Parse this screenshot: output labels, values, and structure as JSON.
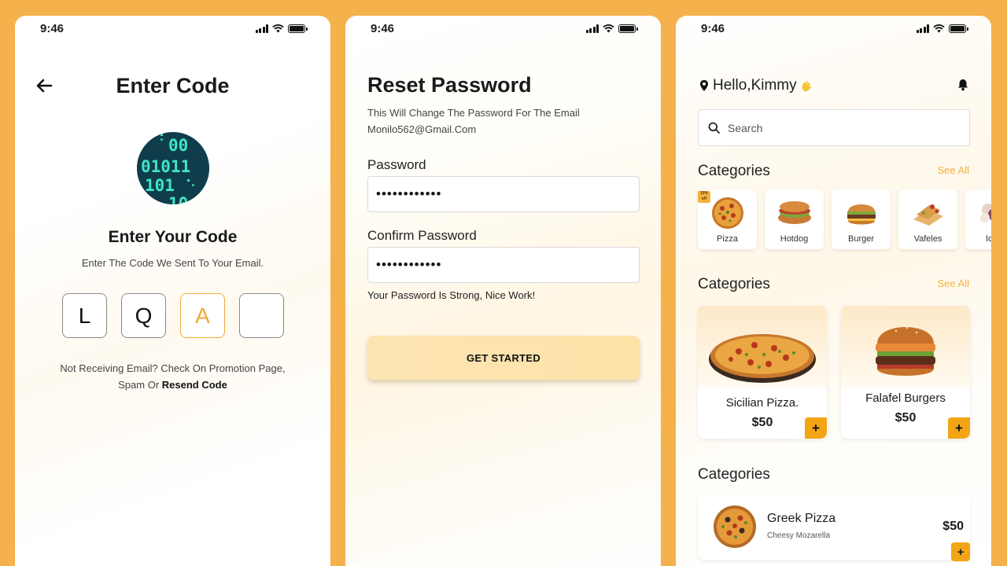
{
  "colors": {
    "background": "#F5B14C",
    "accent": "#F3A515",
    "active_code": "#F0A93B",
    "see_all": "#F3B23E"
  },
  "screen_enter_code": {
    "status_time": "9:46",
    "title": "Enter Code",
    "subtitle": "Enter Your Code",
    "description": "Enter The Code We Sent To Your Email.",
    "code_boxes": [
      "L",
      "Q",
      "A",
      ""
    ],
    "note_prefix": "Not Receiving Email? Check On Promotion Page,",
    "note_line2": "Spam Or ",
    "resend_label": "Resend Code",
    "binary_digits": [
      "00",
      "01011",
      "101",
      "10"
    ]
  },
  "screen_reset_password": {
    "status_time": "9:46",
    "title": "Reset Password",
    "description_line1": "This Will Change The Password For The Email",
    "description_line2": "Monilo562@Gmail.Com",
    "password_label": "Password",
    "password_value": "••••••••••••",
    "confirm_label": "Confirm Password",
    "confirm_value": "••••••••••••",
    "strength_note": "Your Password Is Strong, Nice Work!",
    "button_label": "GET STARTED"
  },
  "screen_home": {
    "status_time": "9:46",
    "greeting": "Hello,Kimmy",
    "search_placeholder": "Search",
    "section1_title": "Categories",
    "section2_title": "Categories",
    "section3_title": "Categories",
    "see_all": "See All",
    "discount_badge": "10% off",
    "categories": [
      {
        "label": "Pizza",
        "icon": "pizza-icon"
      },
      {
        "label": "Hotdog",
        "icon": "hotdog-icon"
      },
      {
        "label": "Burger",
        "icon": "burger-icon"
      },
      {
        "label": "Vafeles",
        "icon": "waffles-icon"
      },
      {
        "label": "Ic",
        "icon": "ice-cream-icon"
      }
    ],
    "featured": [
      {
        "name": "Sicilian Pizza.",
        "price": "$50"
      },
      {
        "name": "Falafel Burgers",
        "price": "$50"
      }
    ],
    "list_item": {
      "name": "Greek Pizza",
      "subtitle": "Cheesy Mozarella",
      "price": "$50"
    },
    "plus_label": "+"
  }
}
